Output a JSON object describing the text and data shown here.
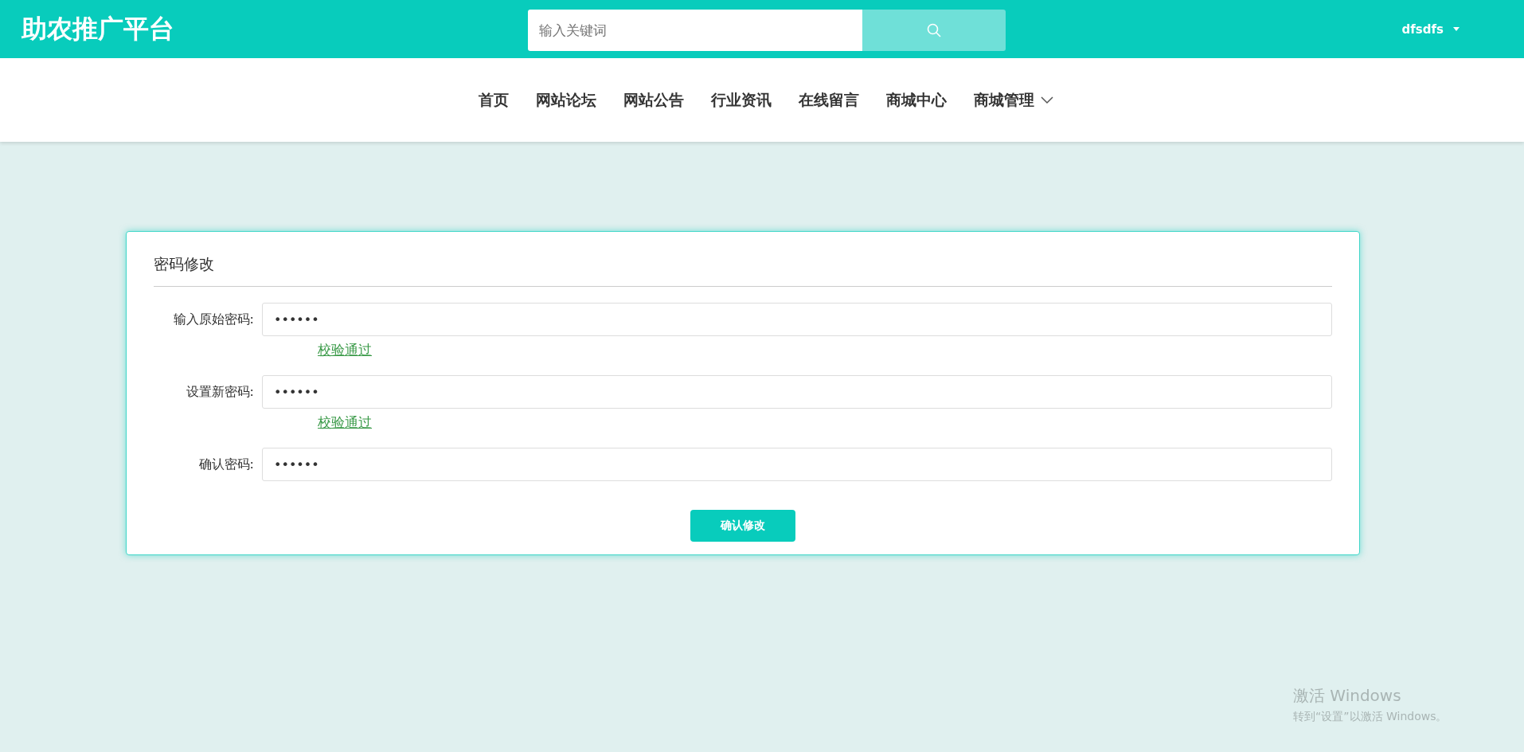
{
  "header": {
    "site_title": "助农推广平台",
    "search": {
      "placeholder": "输入关键词"
    },
    "user": {
      "name": "dfsdfs"
    }
  },
  "nav": [
    {
      "label": "首页",
      "dropdown": false
    },
    {
      "label": "网站论坛",
      "dropdown": false
    },
    {
      "label": "网站公告",
      "dropdown": false
    },
    {
      "label": "行业资讯",
      "dropdown": false
    },
    {
      "label": "在线留言",
      "dropdown": false
    },
    {
      "label": "商城中心",
      "dropdown": false
    },
    {
      "label": "商城管理",
      "dropdown": true
    }
  ],
  "form": {
    "title": "密码修改",
    "fields": [
      {
        "label": "输入原始密码:",
        "value": "••••••",
        "hint": {
          "text": "校验通过",
          "valid": true
        }
      },
      {
        "label": "设置新密码:",
        "value": "••••••",
        "hint": {
          "text": "校验通过",
          "valid": true
        }
      },
      {
        "label": "确认密码:",
        "value": "••••••"
      }
    ],
    "submit": "确认修改"
  },
  "activation_notice": {
    "title": "激活 Windows",
    "text": "转到“设置”以激活 Windows。"
  }
}
